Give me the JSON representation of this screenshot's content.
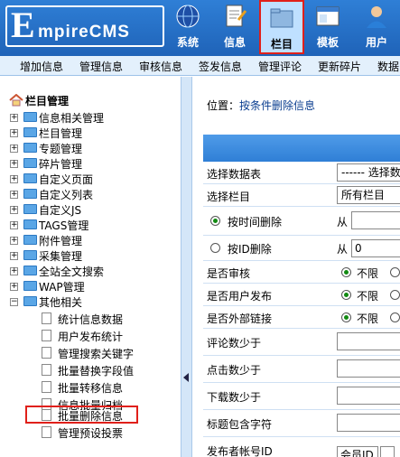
{
  "header": {
    "logo_letter": "E",
    "logo_text": "mpireCMS",
    "nav": [
      {
        "label": "系统",
        "icon": "globe-icon"
      },
      {
        "label": "信息",
        "icon": "document-icon"
      },
      {
        "label": "栏目",
        "icon": "folder-icon",
        "active": true
      },
      {
        "label": "模板",
        "icon": "window-icon"
      },
      {
        "label": "用户",
        "icon": "user-icon"
      }
    ]
  },
  "menubar": [
    "增加信息",
    "管理信息",
    "审核信息",
    "签发信息",
    "管理评论",
    "更新碎片",
    "数据"
  ],
  "sidebar": {
    "title": "栏目管理",
    "top_items": [
      "信息相关管理",
      "栏目管理",
      "专题管理",
      "碎片管理",
      "自定义页面",
      "自定义列表",
      "自定义JS",
      "TAGS管理",
      "附件管理",
      "采集管理",
      "全站全文搜索",
      "WAP管理"
    ],
    "group": "其他相关",
    "sub_items": [
      "统计信息数据",
      "用户发布统计",
      "管理搜索关键字",
      "批量替换字段值",
      "批量转移信息",
      "信息批量归档",
      "批量删除信息",
      "管理预设投票"
    ],
    "highlight": "批量删除信息"
  },
  "main": {
    "location_label": "位置：",
    "location_link": "按条件删除信息",
    "rows": [
      {
        "label": "选择数据表",
        "value": "------ 选择数"
      },
      {
        "label": "选择栏目",
        "value": "所有栏目"
      },
      {
        "label": "按时间删除",
        "from": "从"
      },
      {
        "label": "按ID删除",
        "from": "从",
        "value": "0"
      },
      {
        "label": "是否审核",
        "opt": "不限"
      },
      {
        "label": "是否用户发布",
        "opt": "不限"
      },
      {
        "label": "是否外部链接",
        "opt": "不限"
      },
      {
        "label": "评论数少于"
      },
      {
        "label": "点击数少于"
      },
      {
        "label": "下载数少于"
      },
      {
        "label": "标题包含字符"
      },
      {
        "label": "发布者帐号ID",
        "value": "会员ID"
      }
    ]
  },
  "colors": {
    "header_blue": "#2f7fd6",
    "menubar": "#e3f0fc",
    "highlight_border": "#e0201a",
    "active_tab_bg": "#bfe0ff"
  }
}
